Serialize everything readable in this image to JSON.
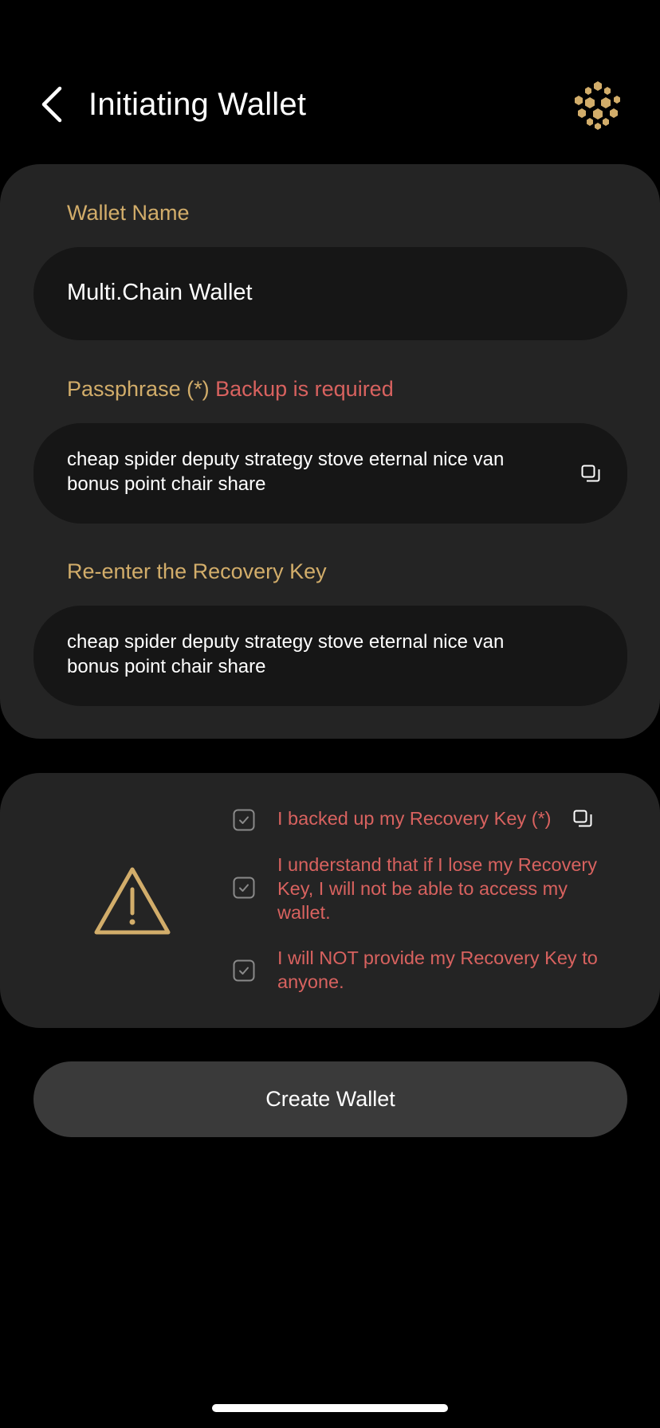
{
  "header": {
    "title": "Initiating Wallet",
    "back_icon": "chevron-left-icon",
    "logo_icon": "hexagon-cluster-logo"
  },
  "form": {
    "wallet_name_label": "Wallet Name",
    "wallet_name_value": "Multi.Chain Wallet",
    "passphrase_label": "Passphrase (*)",
    "passphrase_warning": "Backup is required",
    "passphrase_value": "cheap spider deputy strategy stove eternal nice van bonus point chair share",
    "reenter_label": "Re-enter the Recovery Key",
    "reenter_value": "cheap spider deputy strategy stove eternal nice van bonus point chair share"
  },
  "acknowledgements": {
    "items": [
      {
        "text": "I backed up my Recovery Key (*)",
        "checked": true
      },
      {
        "text": "I understand that if I lose my Recovery Key, I will not be able to access my wallet.",
        "checked": true
      },
      {
        "text": "I will NOT provide my Recovery Key to anyone.",
        "checked": true
      }
    ]
  },
  "actions": {
    "create_label": "Create Wallet"
  },
  "colors": {
    "accent_gold": "#d2ad6a",
    "warning_red": "#d8625f",
    "card_bg": "#242424",
    "field_bg": "#161616",
    "button_bg": "#3a3a3a"
  }
}
